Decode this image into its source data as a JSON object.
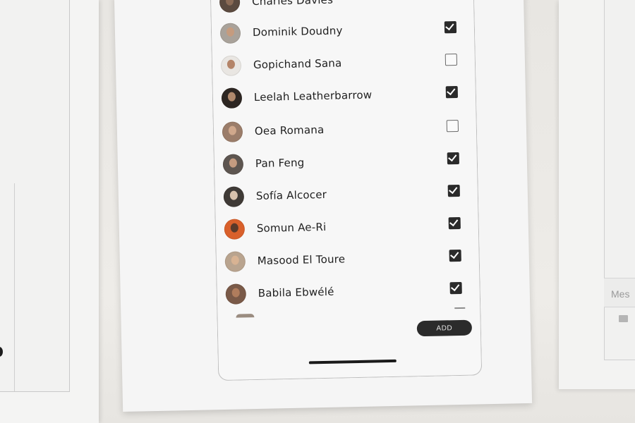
{
  "contacts": [
    {
      "name": "Charles Davies",
      "checked": null,
      "avatar_bg": "#5b4a3f",
      "avatar_face": "#8a6a55"
    },
    {
      "name": "Dominik Doudny",
      "checked": true,
      "avatar_bg": "#a9a29a",
      "avatar_face": "#c59b7e"
    },
    {
      "name": "Gopichand Sana",
      "checked": false,
      "avatar_bg": "#e9e6e2",
      "avatar_face": "#b48468"
    },
    {
      "name": "Leelah Leatherbarrow",
      "checked": true,
      "avatar_bg": "#2d2622",
      "avatar_face": "#b0896d"
    },
    {
      "name": "Oea Romana",
      "checked": false,
      "avatar_bg": "#9b7d6a",
      "avatar_face": "#d0a88c"
    },
    {
      "name": "Pan Feng",
      "checked": true,
      "avatar_bg": "#5d5550",
      "avatar_face": "#c49b80"
    },
    {
      "name": "Sofía Alcocer",
      "checked": true,
      "avatar_bg": "#3f3a36",
      "avatar_face": "#d8c2ad"
    },
    {
      "name": "Somun Ae-Ri",
      "checked": true,
      "avatar_bg": "#d9602b",
      "avatar_face": "#5a3a2a"
    },
    {
      "name": "Masood El Toure",
      "checked": true,
      "avatar_bg": "#b9a48f",
      "avatar_face": "#d8b393"
    },
    {
      "name": "Babila Ebwélé",
      "checked": true,
      "avatar_bg": "#7a5a48",
      "avatar_face": "#b07d5d"
    }
  ],
  "add_button_label": "ADD",
  "right_sheet": {
    "message_placeholder": "Mes"
  },
  "colors": {
    "accent": "#2b2b2b",
    "checkbox_checked": "#2a2a2a"
  }
}
